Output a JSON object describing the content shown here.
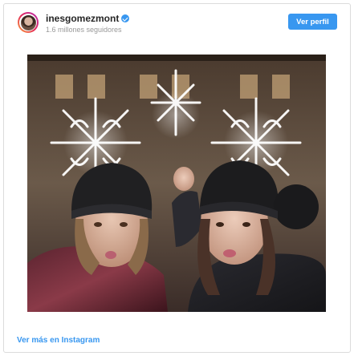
{
  "header": {
    "username": "inesgomezmont",
    "followers": "1.6 millones seguidores",
    "profile_button": "Ver perfil"
  },
  "post": {
    "image_label": "photo"
  },
  "footer": {
    "link": "Ver más en Instagram"
  },
  "colors": {
    "accent": "#3897f0",
    "text": "#262626",
    "muted": "#999999",
    "border": "#dbdbdb"
  },
  "icons": {
    "verified": "verified-badge-icon"
  }
}
